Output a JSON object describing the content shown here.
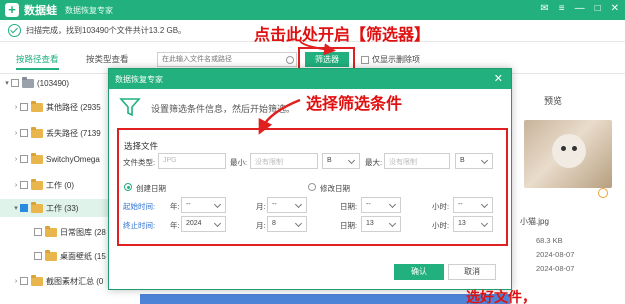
{
  "app": {
    "name": "数据蛙",
    "subtitle": "数据恢复专家",
    "logo_glyph": "+"
  },
  "window_controls": [
    "mail-icon",
    "menu-icon",
    "minimize-icon",
    "maximize-icon",
    "close-icon"
  ],
  "status": {
    "text": "扫描完成，找到103490个文件共计13.2 GB。"
  },
  "toolbar": {
    "tab_path": "按路径查看",
    "tab_type": "按类型查看",
    "search_placeholder": "在此输入文件名或路径",
    "filter_label": "筛选器",
    "show_deleted_label": "仅显示删除项"
  },
  "tree": [
    {
      "label": "(103490)",
      "level": 0,
      "expanded": true,
      "folder": "gray",
      "selected": false
    },
    {
      "label": "其他路径 (2935",
      "level": 1,
      "expanded": false,
      "folder": "yellow",
      "selected": false
    },
    {
      "label": "丢失路径 (7139",
      "level": 1,
      "expanded": false,
      "folder": "yellow",
      "selected": false
    },
    {
      "label": "SwitchyOmega",
      "level": 1,
      "expanded": false,
      "folder": "yellow",
      "selected": false
    },
    {
      "label": "工作 (0)",
      "level": 1,
      "expanded": false,
      "folder": "yellow",
      "selected": false
    },
    {
      "label": "工作 (33)",
      "level": 1,
      "expanded": true,
      "folder": "yellow",
      "selected": true
    },
    {
      "label": "日常图库 (28",
      "level": 2,
      "expanded": false,
      "folder": "yellow",
      "selected": false
    },
    {
      "label": "桌面壁纸 (15",
      "level": 2,
      "expanded": false,
      "folder": "yellow",
      "selected": false
    },
    {
      "label": "截图素材汇总 (0",
      "level": 1,
      "expanded": false,
      "folder": "yellow",
      "selected": false
    }
  ],
  "preview": {
    "title": "预览",
    "file_name": "小猫.jpg",
    "size": "68.3 KB",
    "date1": "2024-08-07",
    "date2": "2024-08-07"
  },
  "dialog": {
    "title": "数据恢复专家",
    "description": "设置筛选条件信息，然后开始筛选。",
    "section_label": "选择文件",
    "file_type_label": "文件类型:",
    "file_type_placeholder": "JPG",
    "min_label": "最小:",
    "min_placeholder": "没有限制",
    "min_unit": "B",
    "max_label": "最大:",
    "max_placeholder": "没有限制",
    "max_unit": "B",
    "radio_created": "创建日期",
    "radio_modified": "修改日期",
    "start_label": "起始时间:",
    "end_label": "终止时间:",
    "year_label": "年:",
    "month_label": "月:",
    "day_label": "日期:",
    "hour_label": "小时:",
    "start": {
      "year": "--",
      "month": "--",
      "day": "--",
      "hour": "--"
    },
    "end": {
      "year": "2024",
      "month": "8",
      "day": "13",
      "hour": "13"
    },
    "ok_label": "确认",
    "cancel_label": "取消"
  },
  "annotations": {
    "open_filter": "点击此处开启【筛选器】",
    "choose_conditions": "选择筛选条件",
    "after_choose": "选好文件，"
  },
  "colors": {
    "accent": "#21b07e",
    "annotation": "#e02020"
  }
}
